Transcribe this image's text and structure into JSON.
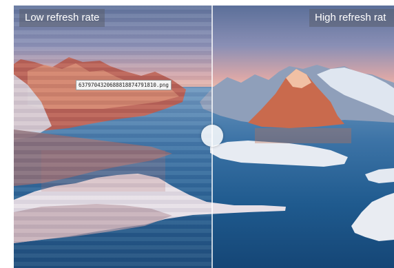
{
  "labels": {
    "left": "Low refresh rate",
    "right": "High refresh rat"
  },
  "tooltip": {
    "filename": "6379704320688818874791810.png"
  },
  "colors": {
    "label_bg": "#5a5f6e",
    "label_text": "#ffffff",
    "water": "#1f5a8e",
    "sky": "#8a8fb5",
    "mountain": "#c9624f",
    "snow": "#eef1f6",
    "divider": "#ffffff"
  }
}
